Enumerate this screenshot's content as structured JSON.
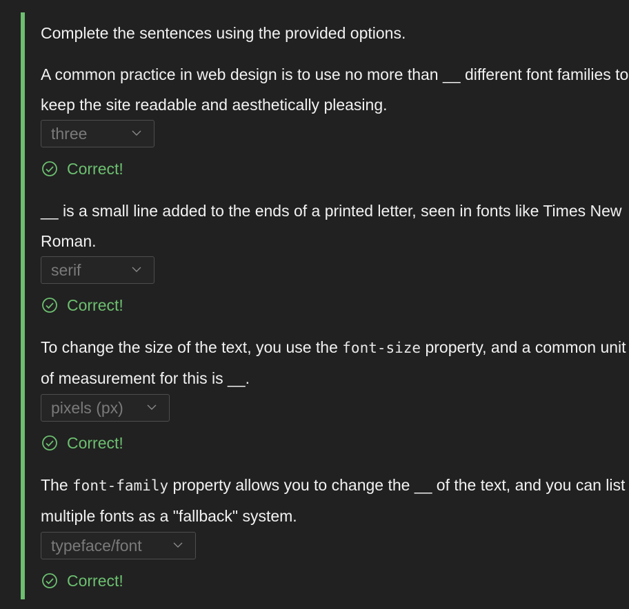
{
  "instructions": "Complete the sentences using the provided options.",
  "questions": [
    {
      "text_before": "A common practice in web design is to use no more than __ different font families to keep the site readable and aesthetically pleasing.",
      "selected": "three",
      "feedback": "Correct!"
    },
    {
      "text_before": "__ is a small line added to the ends of a printed letter, seen in fonts like Times New Roman.",
      "selected": "serif",
      "feedback": "Correct!"
    },
    {
      "text_before": "To change the size of the text, you use the ",
      "code": "font-size",
      "text_after": " property, and a common unit of measurement for this is __.",
      "selected": "pixels (px)",
      "feedback": "Correct!"
    },
    {
      "text_before": "The ",
      "code": "font-family",
      "text_after": " property allows you to change the __ of the text, and you can list multiple fonts as a \"fallback\" system.",
      "selected": "typeface/font",
      "feedback": "Correct!"
    }
  ],
  "colors": {
    "accent": "#6cc070",
    "background": "#212121",
    "text": "#f2f2f2",
    "disabled_text": "#7a7a7a"
  },
  "icons": {
    "feedback": "check-circle-icon",
    "dropdown": "chevron-down-icon"
  }
}
